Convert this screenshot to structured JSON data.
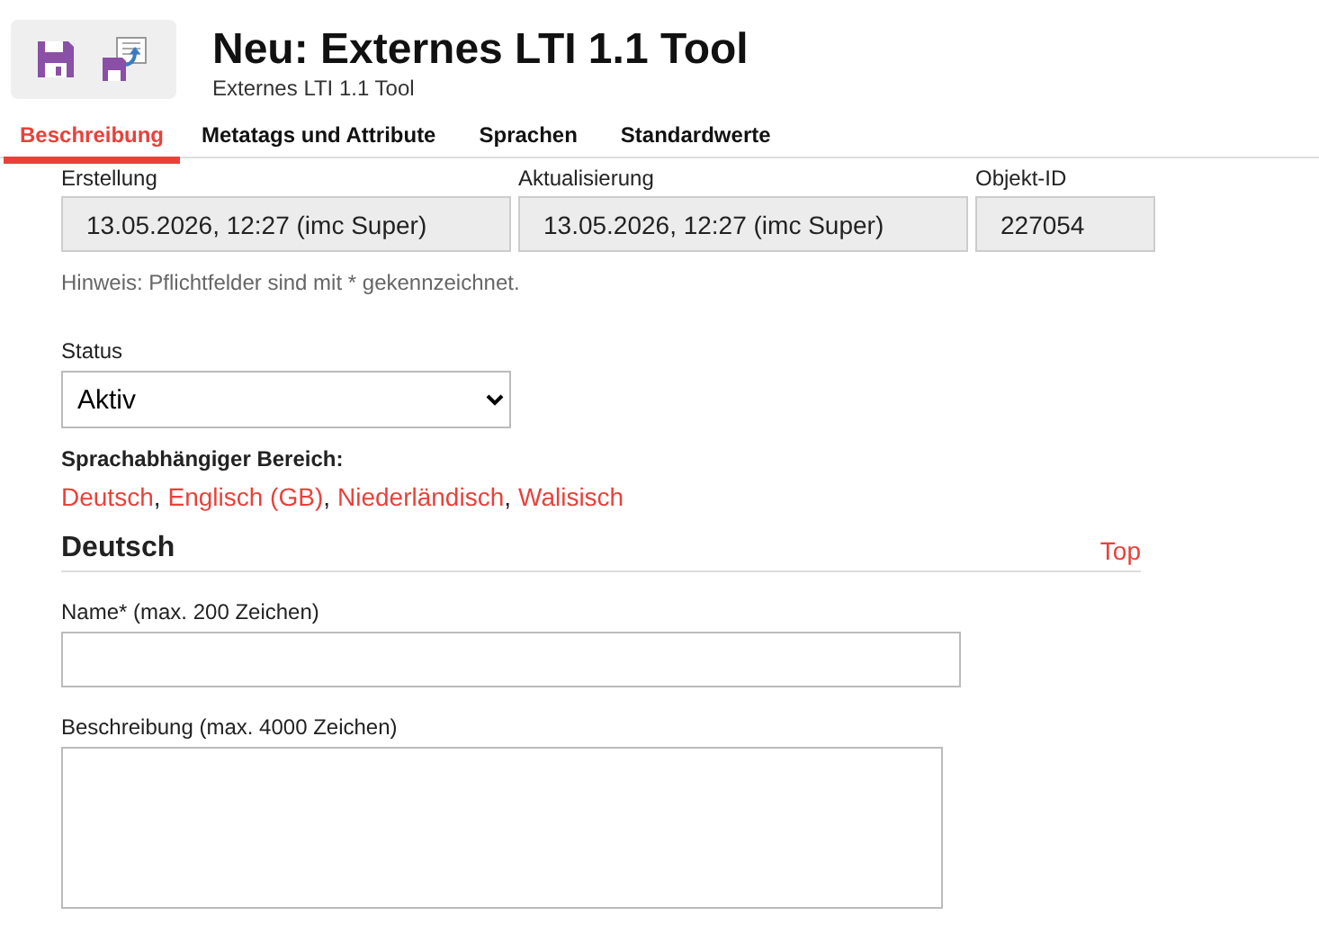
{
  "header": {
    "title": "Neu: Externes LTI 1.1 Tool",
    "subtitle": "Externes LTI 1.1 Tool"
  },
  "tabs": [
    {
      "label": "Beschreibung",
      "selected": true
    },
    {
      "label": "Metatags und Attribute",
      "selected": false
    },
    {
      "label": "Sprachen",
      "selected": false
    },
    {
      "label": "Standardwerte",
      "selected": false
    }
  ],
  "info_fields": [
    {
      "label": "Erstellung",
      "value": "13.05.2026, 12:27 (imc Super)"
    },
    {
      "label": "Aktualisierung",
      "value": "13.05.2026, 12:27 (imc Super)"
    },
    {
      "label": "Objekt-ID",
      "value": "227054"
    }
  ],
  "hint": "Hinweis: Pflichtfelder sind mit * gekennzeichnet.",
  "status": {
    "label": "Status",
    "value": "Aktiv"
  },
  "languages": {
    "label": "Sprachabhängiger Bereich:",
    "separator": ",",
    "links": [
      "Deutsch",
      "Englisch (GB)",
      "Niederländisch",
      "Walisisch"
    ]
  },
  "section": {
    "title": "Deutsch",
    "top_link": "Top"
  },
  "name_field": {
    "label": "Name* (max. 200 Zeichen)"
  },
  "description_field": {
    "label": "Beschreibung (max. 4000 Zeichen)"
  }
}
